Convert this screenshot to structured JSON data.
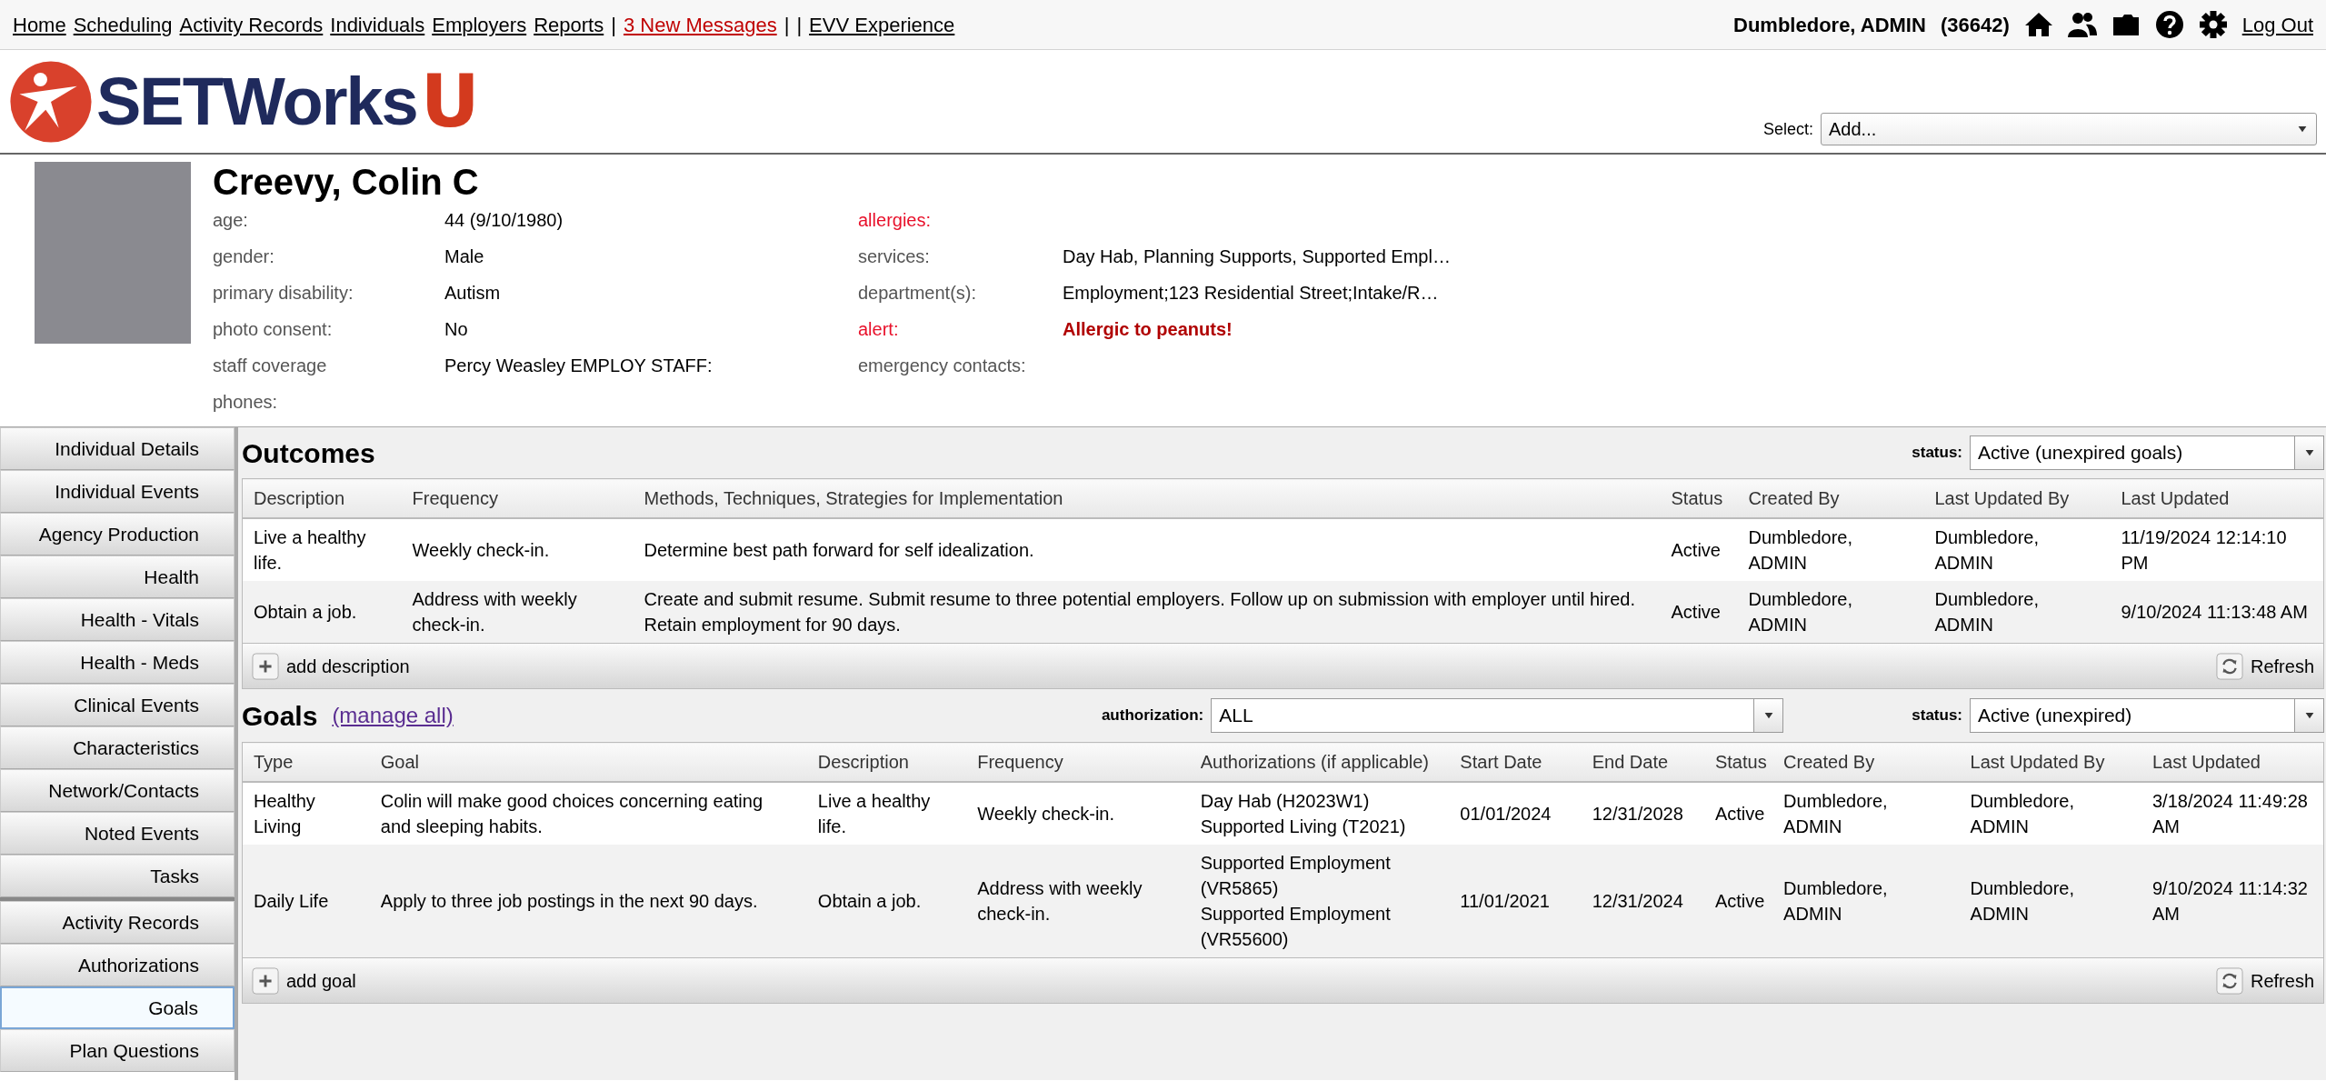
{
  "top_nav": [
    {
      "label": "Home",
      "kind": "link"
    },
    {
      "label": "Scheduling",
      "kind": "link"
    },
    {
      "label": "Activity Records",
      "kind": "link"
    },
    {
      "label": "Individuals",
      "kind": "link"
    },
    {
      "label": "Employers",
      "kind": "link"
    },
    {
      "label": "Reports",
      "kind": "link"
    },
    {
      "label": "|",
      "kind": "separator"
    },
    {
      "label": "3 New Messages",
      "kind": "alert"
    },
    {
      "label": "|",
      "kind": "separator"
    },
    {
      "label": "|",
      "kind": "separator"
    },
    {
      "label": "EVV Experience",
      "kind": "link"
    }
  ],
  "user": {
    "name": "Dumbledore, ADMIN",
    "id": "(36642)",
    "logout": "Log Out"
  },
  "logo": {
    "text": "SETWorks",
    "suffix": "U"
  },
  "add_select": {
    "label": "Select:",
    "value": "Add..."
  },
  "profile": {
    "name": "Creevy, Colin C",
    "left_fields": [
      {
        "label": "age:",
        "value": "44 (9/10/1980)"
      },
      {
        "label": "gender:",
        "value": "Male"
      },
      {
        "label": "primary disability:",
        "value": "Autism"
      },
      {
        "label": "photo consent:",
        "value": "No"
      },
      {
        "label": "staff coverage",
        "value": "Percy Weasley EMPLOY STAFF:"
      },
      {
        "label": "phones:"
      }
    ],
    "right_fields": [
      {
        "label": "allergies:",
        "highlight": true
      },
      {
        "label": "services:",
        "value": "Day Hab, Planning Supports, Supported Empl…",
        "highlight": false
      },
      {
        "label": "department(s):",
        "value": "Employment;123 Residential Street;Intake/R…",
        "highlight": false
      },
      {
        "label": "alert:",
        "value": "Allergic to peanuts!",
        "highlight": true
      },
      {
        "label": "emergency contacts:",
        "highlight": false
      }
    ]
  },
  "sidebar": {
    "sections": [
      {
        "items": [
          {
            "label": "Individual Details",
            "selected": false
          },
          {
            "label": "Individual Events",
            "selected": false
          },
          {
            "label": "Agency Production",
            "selected": false
          },
          {
            "label": "Health",
            "selected": false
          },
          {
            "label": "Health - Vitals",
            "selected": false
          },
          {
            "label": "Health - Meds",
            "selected": false
          },
          {
            "label": "Clinical Events",
            "selected": false
          },
          {
            "label": "Characteristics",
            "selected": false
          },
          {
            "label": "Network/Contacts",
            "selected": false
          },
          {
            "label": "Noted Events",
            "selected": false
          },
          {
            "label": "Tasks",
            "selected": false
          }
        ]
      },
      {
        "items": [
          {
            "label": "Activity Records",
            "selected": false
          },
          {
            "label": "Authorizations",
            "selected": false
          },
          {
            "label": "Goals",
            "selected": true
          },
          {
            "label": "Plan Questions",
            "selected": false
          }
        ]
      }
    ]
  },
  "outcomes": {
    "title": "Outcomes",
    "status_label": "status:",
    "status_value": "Active (unexpired goals)",
    "columns": [
      "Description",
      "Frequency",
      "Methods, Techniques, Strategies for Implementation",
      "Status",
      "Created By",
      "Last Updated By",
      "Last Updated"
    ],
    "rows": [
      [
        "Live a healthy life.",
        "Weekly check-in.",
        "Determine best path forward for self idealization.",
        "Active",
        "Dumbledore, ADMIN",
        "Dumbledore, ADMIN",
        "11/19/2024 12:14:10 PM"
      ],
      [
        "Obtain a job.",
        "Address with weekly check-in.",
        "Create and submit resume. Submit resume to three potential employers. Follow up on submission with employer until hired. Retain employment for 90 days.",
        "Active",
        "Dumbledore, ADMIN",
        "Dumbledore, ADMIN",
        "9/10/2024 11:13:48 AM"
      ]
    ],
    "add_label": "add description",
    "refresh_label": "Refresh"
  },
  "goals": {
    "title": "Goals",
    "link": "(manage all)",
    "authorization_label": "authorization:",
    "authorization_value": "ALL",
    "status_label": "status:",
    "status_value": "Active (unexpired)",
    "columns": [
      "Type",
      "Goal",
      "Description",
      "Frequency",
      "Authorizations (if applicable)",
      "Start Date",
      "End Date",
      "Status",
      "Created By",
      "Last Updated By",
      "Last Updated"
    ],
    "rows": [
      [
        "Healthy Living",
        "Colin will make good choices concerning eating and sleeping habits.",
        "Live a healthy life.",
        "Weekly check-in.",
        [
          "Day Hab (H2023W1)",
          "Supported Living (T2021)"
        ],
        "01/01/2024",
        "12/31/2028",
        "Active",
        "Dumbledore, ADMIN",
        "Dumbledore, ADMIN",
        "3/18/2024 11:49:28 AM"
      ],
      [
        "Daily Life",
        "Apply to three job postings in the next 90 days.",
        "Obtain a job.",
        "Address with weekly check-in.",
        [
          "Supported Employment (VR5865)",
          "Supported Employment (VR55600)"
        ],
        "11/01/2021",
        "12/31/2024",
        "Active",
        "Dumbledore, ADMIN",
        "Dumbledore, ADMIN",
        "9/10/2024 11:14:32 AM"
      ]
    ],
    "add_label": "add goal",
    "refresh_label": "Refresh"
  }
}
